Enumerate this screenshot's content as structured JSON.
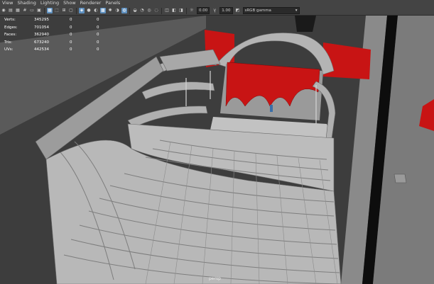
{
  "menu": [
    "View",
    "Shading",
    "Lighting",
    "Show",
    "Renderer",
    "Panels"
  ],
  "toolbar": {
    "exposure": "0.00",
    "gamma": "1.00",
    "color_space": "sRGB gamma",
    "icons": [
      "camera-icon",
      "bookmark-icon",
      "image-plane-icon",
      "grid-icon",
      "film-gate-icon",
      "resolution-gate-icon",
      "gate-mask-icon",
      "field-chart-icon",
      "safe-action-icon",
      "wireframe-icon",
      "smooth-shade-icon",
      "default-material-icon",
      "textured-icon",
      "use-lights-icon",
      "shadows-icon",
      "screen-space-ao-icon",
      "motion-blur-icon",
      "antialias-icon",
      "depth-of-field-icon",
      "isolate-select-icon",
      "xray-icon",
      "xray-active-icon",
      "xray-joints-icon",
      "exposure-icon",
      "gamma-icon",
      "view-transform-icon"
    ]
  },
  "hud": {
    "rows": [
      {
        "label": "Verts:",
        "value": "345295",
        "sel": "0",
        "comp": "0"
      },
      {
        "label": "Edges:",
        "value": "701054",
        "sel": "0",
        "comp": "0"
      },
      {
        "label": "Faces:",
        "value": "362940",
        "sel": "0",
        "comp": "0"
      },
      {
        "label": "Tris:",
        "value": "673240",
        "sel": "0",
        "comp": "0"
      },
      {
        "label": "UVs:",
        "value": "442534",
        "sel": "0",
        "comp": "0"
      }
    ]
  },
  "camera": "persp",
  "colors": {
    "background": "#3c3c3c",
    "model": "#a3a3a3",
    "curtain": "#c81414",
    "selection": "#5d8fbf"
  }
}
